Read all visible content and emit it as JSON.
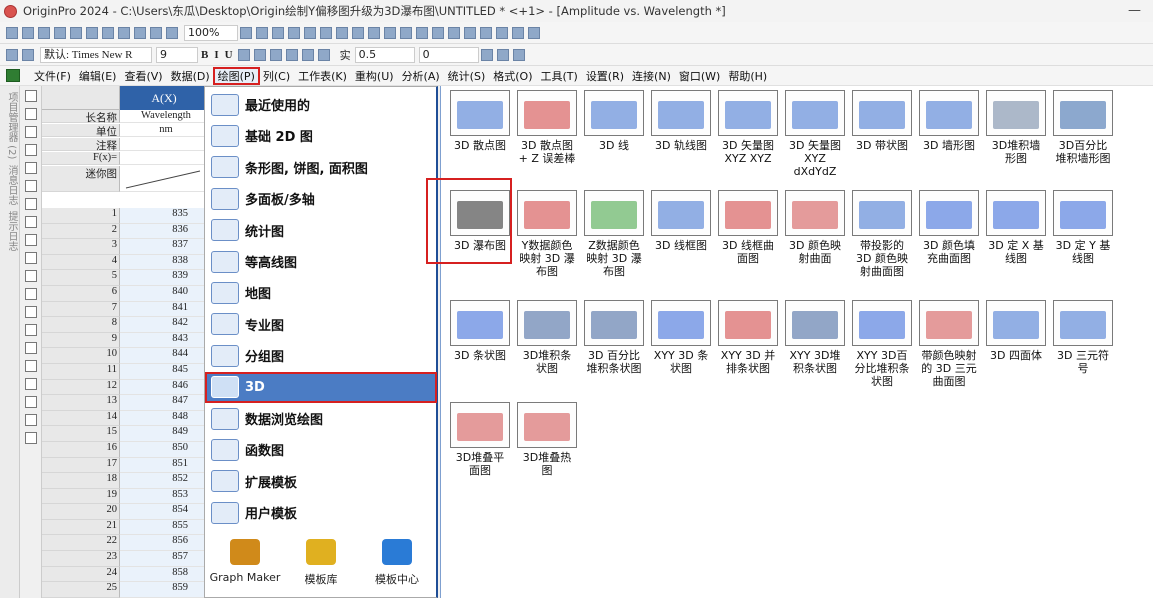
{
  "titlebar": {
    "title": "OriginPro 2024 - C:\\Users\\东瓜\\Desktop\\Origin绘制Y偏移图升级为3D瀑布图\\UNTITLED * <+1> - [Amplitude vs. Wavelength *]",
    "minimize": "—"
  },
  "toolbar1": {
    "zoom": "100%"
  },
  "toolbar2": {
    "font": "默认: Times New R",
    "size": "9",
    "bold": "B",
    "italic": "I",
    "underline": "U",
    "line_style": "实",
    "line_width": "0.5",
    "value_0": "0"
  },
  "menubar": {
    "items": [
      "文件(F)",
      "编辑(E)",
      "查看(V)",
      "数据(D)",
      "绘图(P)",
      "列(C)",
      "工作表(K)",
      "重构(U)",
      "分析(A)",
      "统计(S)",
      "格式(O)",
      "工具(T)",
      "设置(R)",
      "连接(N)",
      "窗口(W)",
      "帮助(H)"
    ]
  },
  "leftstrip": {
    "label1": "项目管理器 (2)",
    "label2": "消息日志",
    "label3": "提示日志"
  },
  "sheet": {
    "column_header": "A(X)",
    "meta_rows": [
      {
        "label": "长名称",
        "value": "Wavelength"
      },
      {
        "label": "单位",
        "value": "nm"
      },
      {
        "label": "注释",
        "value": ""
      },
      {
        "label": "F(x)=",
        "value": ""
      },
      {
        "label": "迷你图",
        "value": ""
      }
    ],
    "rows": [
      {
        "n": "1",
        "v": "835"
      },
      {
        "n": "2",
        "v": "836"
      },
      {
        "n": "3",
        "v": "837"
      },
      {
        "n": "4",
        "v": "838"
      },
      {
        "n": "5",
        "v": "839"
      },
      {
        "n": "6",
        "v": "840"
      },
      {
        "n": "7",
        "v": "841"
      },
      {
        "n": "8",
        "v": "842"
      },
      {
        "n": "9",
        "v": "843"
      },
      {
        "n": "10",
        "v": "844"
      },
      {
        "n": "11",
        "v": "845"
      },
      {
        "n": "12",
        "v": "846"
      },
      {
        "n": "13",
        "v": "847"
      },
      {
        "n": "14",
        "v": "848"
      },
      {
        "n": "15",
        "v": "849"
      },
      {
        "n": "16",
        "v": "850"
      },
      {
        "n": "17",
        "v": "851"
      },
      {
        "n": "18",
        "v": "852"
      },
      {
        "n": "19",
        "v": "853"
      },
      {
        "n": "20",
        "v": "854"
      },
      {
        "n": "21",
        "v": "855"
      },
      {
        "n": "22",
        "v": "856"
      },
      {
        "n": "23",
        "v": "857"
      },
      {
        "n": "24",
        "v": "858"
      },
      {
        "n": "25",
        "v": "859"
      }
    ]
  },
  "dropdown": {
    "items": [
      {
        "label": "最近使用的",
        "icon": "clock-icon"
      },
      {
        "label": "基础 2D 图",
        "icon": "line-chart-icon"
      },
      {
        "label": "条形图, 饼图, 面积图",
        "icon": "bar-chart-icon"
      },
      {
        "label": "多面板/多轴",
        "icon": "multipanel-icon"
      },
      {
        "label": "统计图",
        "icon": "histogram-icon"
      },
      {
        "label": "等高线图",
        "icon": "contour-icon"
      },
      {
        "label": "地图",
        "icon": "map-icon"
      },
      {
        "label": "专业图",
        "icon": "specialized-icon"
      },
      {
        "label": "分组图",
        "icon": "grouped-icon"
      },
      {
        "label": "3D",
        "icon": "3d-icon"
      },
      {
        "label": "数据浏览绘图",
        "icon": "browse-icon"
      },
      {
        "label": "函数图",
        "icon": "function-icon"
      },
      {
        "label": "扩展模板",
        "icon": "extend-template-icon"
      },
      {
        "label": "用户模板",
        "icon": "user-template-icon"
      }
    ],
    "selected_index": 9,
    "bottom": [
      {
        "label": "Graph Maker",
        "icon": "graph-maker-icon",
        "color": "#d08a1a"
      },
      {
        "label": "模板库",
        "icon": "template-library-icon",
        "color": "#e0b020"
      },
      {
        "label": "模板中心",
        "icon": "cloud-download-icon",
        "color": "#2a7bd6"
      }
    ]
  },
  "gallery": {
    "items": [
      {
        "label": "3D 散点图",
        "color": "#3a6fd0"
      },
      {
        "label": "3D 散点图\n+ Z 误差棒",
        "color": "#d03a3a"
      },
      {
        "label": "3D 线",
        "color": "#3a6fd0"
      },
      {
        "label": "3D 轨线图",
        "color": "#3a6fd0"
      },
      {
        "label": "3D 矢量图\nXYZ XYZ",
        "color": "#3a6fd0"
      },
      {
        "label": "3D 矢量图\nXYZ\ndXdYdZ",
        "color": "#3a6fd0"
      },
      {
        "label": "3D 带状图",
        "color": "#3a6fd0"
      },
      {
        "label": "3D 墙形图",
        "color": "#3a6fd0"
      },
      {
        "label": "3D堆积墙\n形图",
        "color": "#6a7f9f"
      },
      {
        "label": "3D百分比\n堆积墙形图",
        "color": "#2f62a8"
      },
      {
        "label": "3D 瀑布图",
        "color": "#222222"
      },
      {
        "label": "Y数据颜色\n映射 3D 瀑\n布图",
        "color": "#d03a3a"
      },
      {
        "label": "Z数据颜色\n映射 3D 瀑\n布图",
        "color": "#3aa03a"
      },
      {
        "label": "3D 线框图",
        "color": "#3a6fd0"
      },
      {
        "label": "3D 线框曲\n面图",
        "color": "#d03a3a"
      },
      {
        "label": "3D 颜色映\n射曲面",
        "color": "#d04a4a"
      },
      {
        "label": "带投影的\n3D 颜色映\n射曲面图",
        "color": "#3a6fd0"
      },
      {
        "label": "3D 颜色填\n充曲面图",
        "color": "#2f62d8"
      },
      {
        "label": "3D 定 X 基\n线图",
        "color": "#2f62d8"
      },
      {
        "label": "3D 定 Y 基\n线图",
        "color": "#2f62d8"
      },
      {
        "label": "3D 条状图",
        "color": "#2f62d8"
      },
      {
        "label": "3D堆积条\n状图",
        "color": "#3a5f9a"
      },
      {
        "label": "3D 百分比\n堆积条状图",
        "color": "#3a5f9a"
      },
      {
        "label": "XYY 3D 条\n状图",
        "color": "#2f62d8"
      },
      {
        "label": "XYY 3D 并\n排条状图",
        "color": "#d03a3a"
      },
      {
        "label": "XYY 3D堆\n积条状图",
        "color": "#3a5f9a"
      },
      {
        "label": "XYY 3D百\n分比堆积条\n状图",
        "color": "#2f62d8"
      },
      {
        "label": "带颜色映射\n的 3D 三元\n曲面图",
        "color": "#d04a4a"
      },
      {
        "label": "3D 四面体",
        "color": "#3a6fd0"
      },
      {
        "label": "3D 三元符\n号",
        "color": "#3a6fd0"
      },
      {
        "label": "3D堆叠平\n面图",
        "color": "#d04a4a"
      },
      {
        "label": "3D堆叠热\n图",
        "color": "#d04a4a"
      }
    ],
    "highlight_index": 10
  }
}
